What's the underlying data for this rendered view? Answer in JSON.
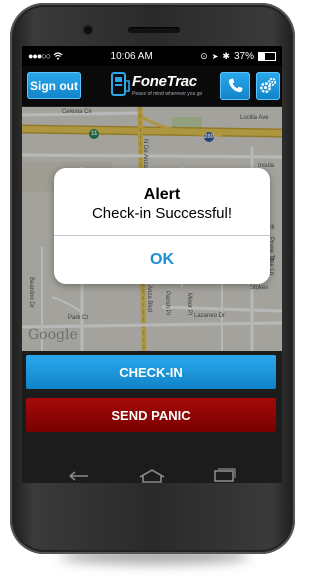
{
  "status_bar": {
    "time": "10:06 AM",
    "battery_text": "37%",
    "battery_level": 0.37
  },
  "app_bar": {
    "sign_out_label": "Sign out",
    "brand_name": "FoneTrac",
    "brand_tagline": "Peace of mind wherever you go",
    "phone_icon": "phone-icon",
    "settings_icon": "gear-icon"
  },
  "map": {
    "labels": {
      "celesta_cir": "Celesta Cir",
      "lucilla_ave": "Lucilla Ave",
      "n_de_anza": "N De Anza",
      "insula": "Insula",
      "merrill": "Merrill",
      "prune_tree": "Prune Tree Ln",
      "rucker": "Rucker",
      "stokes": "Stokes",
      "park_ct": "Park Ct",
      "parish_pl": "Parish Pl",
      "minor_pl": "Minor Pl",
      "lazaneo": "Lazaneo Dr",
      "beardon": "Beardon Dr",
      "de_anza_blvd": "Anza Blvd",
      "hwy_280": "280",
      "hwy_11": "11"
    },
    "attribution": "Google"
  },
  "alert": {
    "title": "Alert",
    "message": "Check-in Successful!",
    "ok_label": "OK"
  },
  "actions": {
    "checkin_label": "CHECK-IN",
    "panic_label": "SEND PANIC"
  },
  "colors": {
    "accent_blue": "#1a8fd6",
    "panic_red": "#8c0303"
  }
}
